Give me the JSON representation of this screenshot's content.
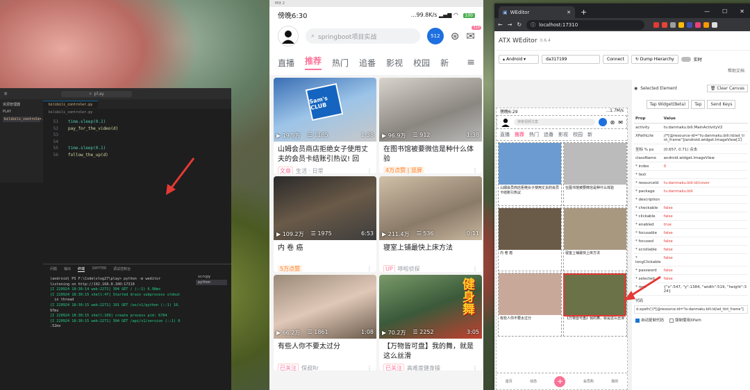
{
  "vscode": {
    "search": "play",
    "side_title": "资源管理器",
    "side_section": "PLAY",
    "file": "bilibili_controler.py",
    "tab": "bilibili_controler.py",
    "crumb": "bilibili_controler.py",
    "code": [
      {
        "n": "51",
        "t": "time.sleep(0.1)"
      },
      {
        "n": "52",
        "t": "pay_for_the_video(d)"
      },
      {
        "n": "53",
        "t": ""
      },
      {
        "n": "54",
        "t": ""
      },
      {
        "n": "55",
        "t": "time.sleep(0.1)"
      },
      {
        "n": "56",
        "t": "follow_the_up(d)"
      }
    ],
    "panel_tabs": [
      "问题",
      "输出",
      "终端",
      "JUPYTER",
      "调试控制台"
    ],
    "terminal": [
      "(android) PS F:\\Code\\vlog27\\play> python -m weditor",
      "listening on http://192.168.0.100:17310",
      "[I 220924 18:30:14 web:2271] 304 GET / (::1) 6.98ms",
      "[I 220924 18:30:15 shell:47] Started drain subprocess stdout",
      "  in thread",
      "[I 220924 18:30:15 web:2271] 101 GET /ws/v1/python (::1) 16.",
      "97ms",
      "[I 220924 18:30:15 shell:109] create process pid: 6704",
      "[I 220924 18:30:15 web:2271] 304 GET /api/v1/version (::1) 0",
      ".52ms"
    ],
    "term_list": [
      "scrcpy",
      "python"
    ]
  },
  "phone": {
    "window_title": "MIX 2",
    "time": "傍晚6:30",
    "speed": "...99.8K/s",
    "battery": "100",
    "search_placeholder": "springboot项目实战",
    "notif_count": "310",
    "tabs": [
      "直播",
      "推荐",
      "热门",
      "追番",
      "影视",
      "校园",
      "新"
    ],
    "cards": [
      {
        "views": "19.5万",
        "comments": "1185",
        "dur": "1:38",
        "title": "山姆会员商店拒绝女子使用丈夫的会员卡结账引热议! 回应...",
        "tag1": "文章",
        "tag2": "生活 · 日常"
      },
      {
        "views": "96.9万",
        "comments": "912",
        "dur": "1:38",
        "title": "在图书馆被要微信是种什么体验",
        "tag1": "4万点赞 | 竖屏",
        "tag2": ""
      },
      {
        "views": "109.2万",
        "comments": "1975",
        "dur": "6:53",
        "title": "内 卷 癌",
        "tag1": "5万点赞",
        "tag2": ""
      },
      {
        "views": "211.4万",
        "comments": "536",
        "dur": "0:11",
        "title": "寝室上铺最快上床方法",
        "tag1": "UP",
        "tag2": "哆啦侦探"
      },
      {
        "views": "66.2万",
        "comments": "1861",
        "dur": "1:08",
        "title": "有些人你不要太过分",
        "tag1": "已关注",
        "tag2": "保叔Rr"
      },
      {
        "views": "70.2万",
        "comments": "2252",
        "dur": "3:05",
        "title": "【万物皆可盘】我的舞，就是这么丝滑",
        "tag1": "已关注",
        "tag2": "高难度健身操"
      }
    ],
    "sams_logo": "Sam's CLUB",
    "fitness_text": "健身舞"
  },
  "browser": {
    "tab_title": "WEditor",
    "url": "localhost:17310",
    "app": "ATX WEditor",
    "version": "0.6.4",
    "platform": "Android",
    "device_id": "da317199",
    "connect": "Connect",
    "dump": "Dump Hierarchy",
    "realtime": "实时",
    "doc_link": "帮助文档",
    "selected": "Selected Element",
    "clear_canvas": "Clear Canvas",
    "btns": [
      "Tap Widget(Beta)",
      "Tap",
      "Send Keys"
    ],
    "prop_h": "Prop",
    "value_h": "Value",
    "props": [
      {
        "k": "activity",
        "v": "tv.danmaku.bili.MainActivityV2",
        "red": false
      },
      {
        "k": "XPathLite",
        "v": "//*[@resource-id=\"tv.danmaku.bili:id/ad_tint_frame\"]/android.widget.ImageView[1]",
        "red": false
      },
      {
        "k": "坐标 % px",
        "v": "(0.657, 0.71) 点击",
        "red": false
      },
      {
        "k": "className",
        "v": "android.widget.ImageView",
        "red": false
      },
      {
        "k": "* index",
        "v": "0",
        "red": true
      },
      {
        "k": "* text",
        "v": "",
        "red": false
      },
      {
        "k": "* resourceId",
        "v": "tv.danmaku.bili:id/cover",
        "red": true
      },
      {
        "k": "* package",
        "v": "tv.danmaku.bili",
        "red": true
      },
      {
        "k": "* description",
        "v": "",
        "red": false
      },
      {
        "k": "* checkable",
        "v": "false",
        "red": true
      },
      {
        "k": "* clickable",
        "v": "false",
        "red": true
      },
      {
        "k": "* enabled",
        "v": "true",
        "red": true
      },
      {
        "k": "* focusable",
        "v": "false",
        "red": true
      },
      {
        "k": "* focused",
        "v": "false",
        "red": true
      },
      {
        "k": "* scrollable",
        "v": "false",
        "red": true
      },
      {
        "k": "* longClickable",
        "v": "false",
        "red": true
      },
      {
        "k": "* password",
        "v": "false",
        "red": true
      },
      {
        "k": "* selected",
        "v": "false",
        "red": true
      },
      {
        "k": "* rect",
        "v": "{\"x\":547, \"y\":1384, \"width\":519, \"height\":324}",
        "red": false
      }
    ],
    "code_label": "代码",
    "code_value": "d.xpath('//*[@resource-id=\"tv.danmaku.bili:id/ad_tint_frame\"]",
    "check1": "自动复制代码",
    "check2": "强制使用XPath",
    "mini": {
      "time": "傍晚6:29",
      "speed": "...1.7M/s",
      "search": "搜索视频文案",
      "tabs": [
        "直播",
        "推荐",
        "热门",
        "追番",
        "影视",
        "校园",
        "新"
      ],
      "titles": [
        "山姆会员商店拒绝女子使用丈夫的会员卡结账引热议",
        "在图书馆被要微信是种什么体验",
        "内 卷 癌",
        "寝室上铺最快上床方法",
        "有些人你不要太过分",
        "【万物皆可盘】我的舞，就是这么丝滑"
      ],
      "bottom": [
        "首页",
        "动态",
        "会员购",
        "我的"
      ]
    }
  },
  "colors": {
    "accent": "#fb7299",
    "vscode_bg": "#1e1e1e",
    "chrome_dark": "#202124",
    "selection": "#e53935"
  }
}
